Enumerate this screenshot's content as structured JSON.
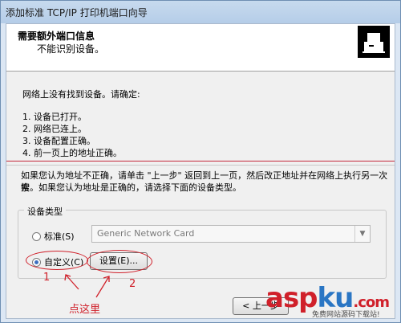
{
  "window": {
    "title": "添加标准 TCP/IP 打印机端口向导"
  },
  "header": {
    "title": "需要额外端口信息",
    "subtitle": "不能识别设备。"
  },
  "body": {
    "intro": "网络上没有找到设备。请确定:",
    "items": [
      "1.  设备已打开。",
      "2.  网络已连上。",
      "3.  设备配置正确。",
      "4.  前一页上的地址正确。"
    ],
    "note_line1": "如果您认为地址不正确，请单击 \"上一步\" 返回到上一页，然后改正地址并在网络上执行另一次搜",
    "note_line2": "索。如果您认为地址是正确的，请选择下面的设备类型。"
  },
  "device_type": {
    "label": "设备类型",
    "standard_label": "标准(S)",
    "standard_value": "Generic Network Card",
    "custom_label": "自定义(C)",
    "settings_label": "设置(E)..."
  },
  "annotations": {
    "one": "1",
    "two": "2",
    "click_here": "点这里"
  },
  "footer": {
    "back_label": "< 上一步"
  },
  "watermark": {
    "brand_a": "asp",
    "brand_b": "ku",
    "brand_c": ".com",
    "sub": "免费网站源码下载站!"
  },
  "colors": {
    "annotation": "#d0202a",
    "radio_on": "#3c6fc0"
  }
}
